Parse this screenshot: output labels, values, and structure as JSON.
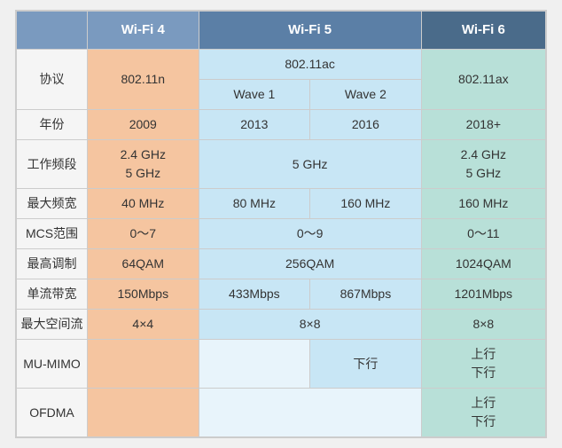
{
  "headers": {
    "label": "",
    "wifi4": "Wi-Fi 4",
    "wifi5": "Wi-Fi 5",
    "wifi6": "Wi-Fi 6"
  },
  "subheaders": {
    "wave1": "Wave",
    "wave2": "Wave 2"
  },
  "rows": [
    {
      "label": "协议",
      "wifi4": "802.11n",
      "wave1": "Wave 1",
      "wave2": "Wave 2",
      "wifi5_header": "802.11ac",
      "wifi6": "802.11ax"
    },
    {
      "label": "年份",
      "wifi4": "2009",
      "wave1": "2013",
      "wave2": "2016",
      "wifi6": "2018+"
    },
    {
      "label": "工作频段",
      "wifi4_line1": "2.4 GHz",
      "wifi4_line2": "5 GHz",
      "wifi5": "5 GHz",
      "wifi6_line1": "2.4 GHz",
      "wifi6_line2": "5 GHz"
    },
    {
      "label": "最大频宽",
      "wifi4": "40 MHz",
      "wave1": "80 MHz",
      "wave2": "160 MHz",
      "wifi6": "160 MHz"
    },
    {
      "label": "MCS范围",
      "wifi4": "0～7",
      "wifi5": "0～9",
      "wifi6": "0～11"
    },
    {
      "label": "最高调制",
      "wifi4": "64QAM",
      "wifi5": "256QAM",
      "wifi6": "1024QAM"
    },
    {
      "label": "单流带宽",
      "wifi4": "150Mbps",
      "wave1": "433Mbps",
      "wave2": "867Mbps",
      "wifi6": "1201Mbps"
    },
    {
      "label": "最大空间流",
      "wifi4": "4×4",
      "wifi5": "8×8",
      "wifi6": "8×8"
    },
    {
      "label": "MU-MIMO",
      "wifi4": "",
      "wave1": "",
      "wave2": "下行",
      "wifi6_line1": "上行",
      "wifi6_line2": "下行"
    },
    {
      "label": "OFDMA",
      "wifi4": "",
      "wifi5": "",
      "wifi6_line1": "上行",
      "wifi6_line2": "下行"
    }
  ]
}
